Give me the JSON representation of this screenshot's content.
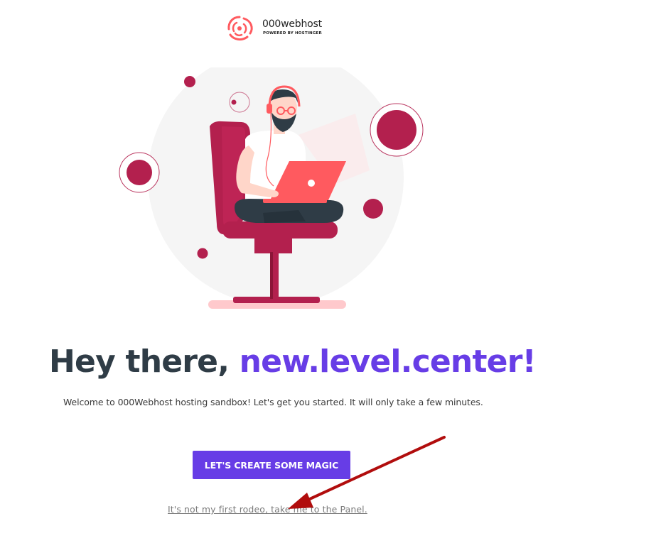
{
  "logo": {
    "name": "000webhost",
    "tagline": "POWERED BY HOSTINGER",
    "icon": "000webhost-swirl-icon"
  },
  "hero": {
    "illustration": "man-with-laptop-on-chair-illustration"
  },
  "headline": {
    "greeting": "Hey there, ",
    "username": "new.level.center!"
  },
  "welcome_text": "Welcome to 000Webhost hosting sandbox! Let's get you started. It will only take a few minutes.",
  "cta": {
    "label": "LET'S CREATE SOME MAGIC"
  },
  "panel_link": {
    "label": "It's not my first rodeo, take me to the Panel."
  },
  "annotation": {
    "icon": "red-arrow-annotation"
  },
  "colors": {
    "accent": "#673de6",
    "heading": "#2f3c46",
    "illustration_primary": "#b3204e",
    "laptop": "#ff5a5f",
    "background": "#ffffff"
  }
}
